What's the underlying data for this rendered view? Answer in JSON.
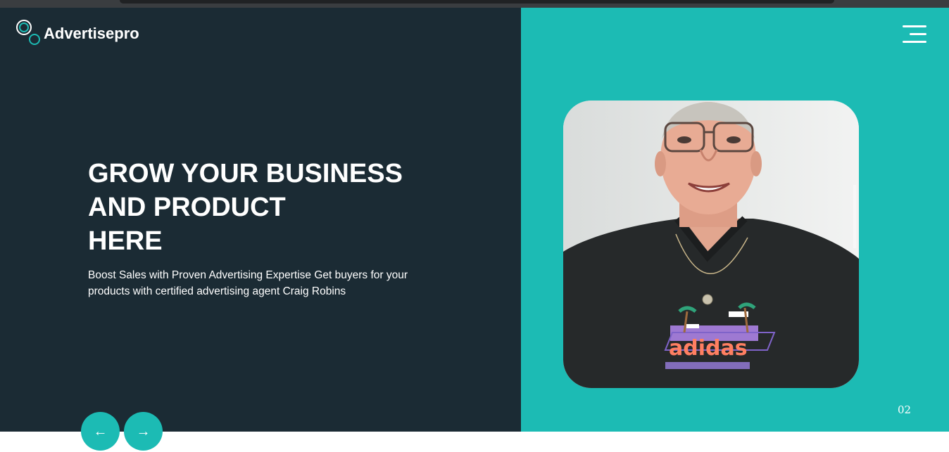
{
  "brand": {
    "name": "Advertisepro",
    "accent_color": "#1cbbb4",
    "dark_color": "#1b2b34"
  },
  "nav": {
    "menu_icon": "hamburger-menu-icon"
  },
  "hero": {
    "headline_lines": [
      "GROW YOUR BUSINESS",
      "AND PRODUCT",
      "HERE"
    ],
    "subtext": "Boost Sales with Proven Advertising Expertise Get buyers for your products with certified advertising agent Craig Robins",
    "slide_number": "02",
    "image": {
      "subject": "smiling man with glasses in black graphic t-shirt",
      "shirt_text": "adidas"
    }
  },
  "slider": {
    "prev_icon": "arrow-left-icon",
    "next_icon": "arrow-right-icon"
  }
}
